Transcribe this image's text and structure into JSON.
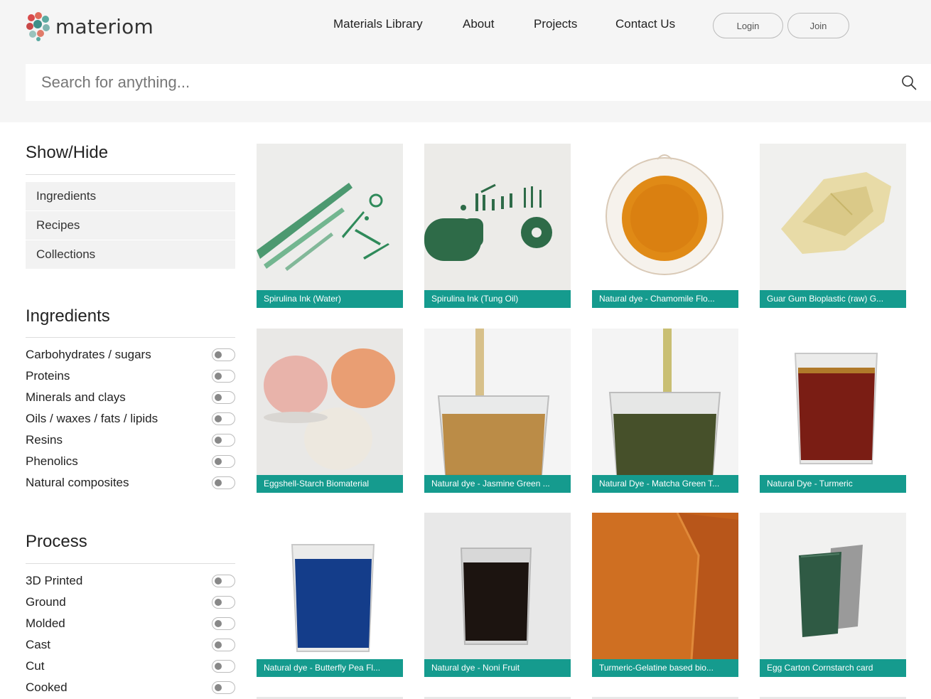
{
  "brand": {
    "name": "materiom"
  },
  "nav": {
    "items": [
      "Materials Library",
      "About",
      "Projects",
      "Contact Us"
    ],
    "login": "Login",
    "join": "Join"
  },
  "search": {
    "placeholder": "Search for anything..."
  },
  "sidebar": {
    "show_hide": {
      "title": "Show/Hide",
      "items": [
        "Ingredients",
        "Recipes",
        "Collections"
      ]
    },
    "ingredients": {
      "title": "Ingredients",
      "items": [
        "Carbohydrates / sugars",
        "Proteins",
        "Minerals and clays",
        "Oils / waxes / fats / lipids",
        "Resins",
        "Phenolics",
        "Natural composites"
      ]
    },
    "process": {
      "title": "Process",
      "items": [
        "3D Printed",
        "Ground",
        "Molded",
        "Cast",
        "Cut",
        "Cooked"
      ]
    }
  },
  "cards": [
    {
      "title": "Spirulina Ink (Water)"
    },
    {
      "title": "Spirulina Ink (Tung Oil)"
    },
    {
      "title": "Natural dye - Chamomile Flo..."
    },
    {
      "title": "Guar Gum Bioplastic (raw) G..."
    },
    {
      "title": "Eggshell-Starch Biomaterial"
    },
    {
      "title": "Natural dye - Jasmine Green ..."
    },
    {
      "title": "Natural Dye - Matcha Green T..."
    },
    {
      "title": "Natural Dye - Turmeric"
    },
    {
      "title": "Natural dye - Butterfly Pea Fl..."
    },
    {
      "title": "Natural dye - Noni Fruit"
    },
    {
      "title": "Turmeric-Gelatine based bio..."
    },
    {
      "title": "Egg Carton Cornstarch card"
    }
  ],
  "icons": {
    "logo": "materiom-logo-icon",
    "search": "search-icon"
  },
  "colors": {
    "accent": "#159b8e",
    "header_bg": "#f5f5f5"
  }
}
